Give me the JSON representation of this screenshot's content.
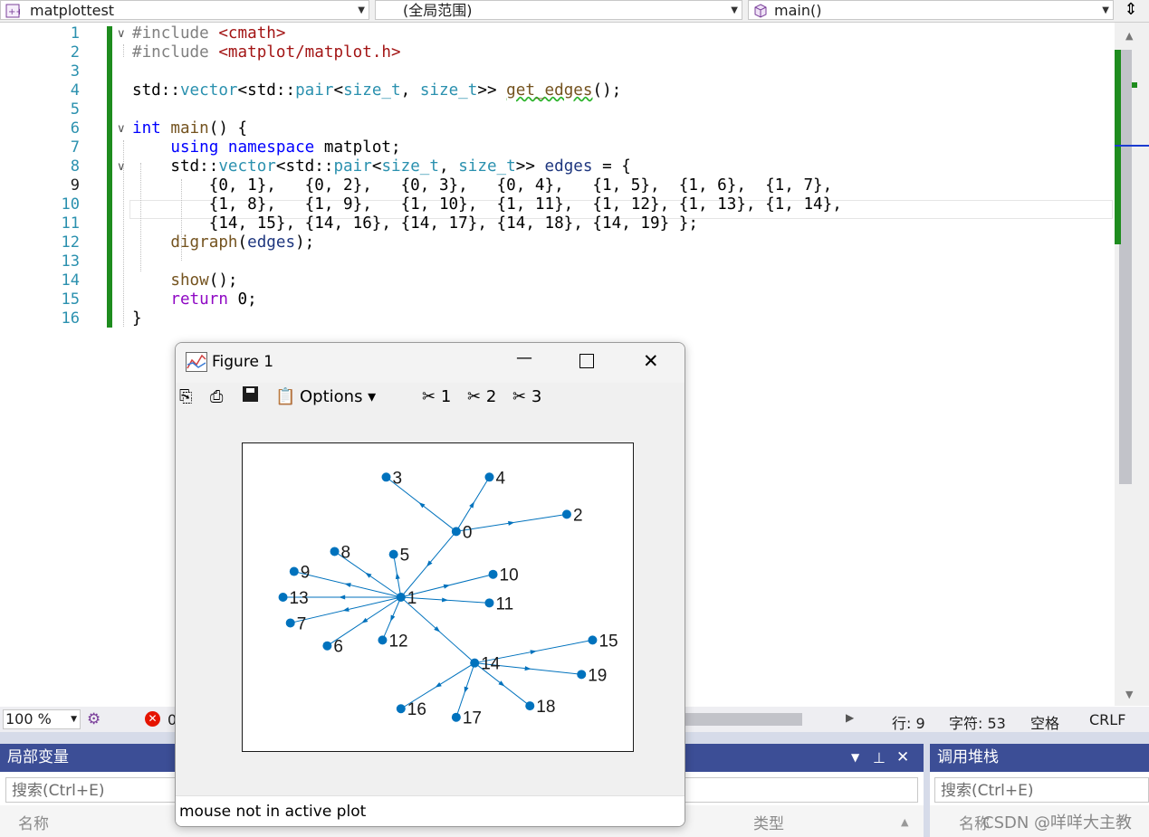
{
  "navbar": {
    "project": "matplottest",
    "scope": "(全局范围)",
    "function": "main()"
  },
  "editor": {
    "line_numbers": [
      "1",
      "2",
      "3",
      "4",
      "5",
      "6",
      "7",
      "8",
      "9",
      "10",
      "11",
      "12",
      "13",
      "14",
      "15",
      "16"
    ],
    "current_line": "9"
  },
  "status": {
    "zoom": "100 %",
    "errors": "0",
    "line": "行: 9",
    "char": "字符: 53",
    "whitespace": "空格",
    "eol": "CRLF"
  },
  "locals_panel": {
    "title": "局部变量",
    "search_placeholder": "搜索(Ctrl+E)",
    "col_name": "名称",
    "col_type": "类型"
  },
  "callstack_panel": {
    "title": "调用堆栈",
    "search_placeholder": "搜索(Ctrl+E)",
    "col_name": "名称"
  },
  "watermark": "CSDN @咩咩大主教",
  "figure": {
    "title": "Figure 1",
    "options_label": "Options",
    "tool_1": "1",
    "tool_2": "2",
    "tool_3": "3",
    "status_text": "mouse not in active plot"
  },
  "chart_data": {
    "type": "digraph",
    "node_color": "#0072bd",
    "nodes": [
      {
        "id": "0",
        "x": 0.55,
        "y": 0.73
      },
      {
        "id": "1",
        "x": 0.4,
        "y": 0.5
      },
      {
        "id": "2",
        "x": 0.85,
        "y": 0.79
      },
      {
        "id": "3",
        "x": 0.36,
        "y": 0.92
      },
      {
        "id": "4",
        "x": 0.64,
        "y": 0.92
      },
      {
        "id": "5",
        "x": 0.38,
        "y": 0.65
      },
      {
        "id": "6",
        "x": 0.2,
        "y": 0.33
      },
      {
        "id": "7",
        "x": 0.1,
        "y": 0.41
      },
      {
        "id": "8",
        "x": 0.22,
        "y": 0.66
      },
      {
        "id": "9",
        "x": 0.11,
        "y": 0.59
      },
      {
        "id": "10",
        "x": 0.65,
        "y": 0.58
      },
      {
        "id": "11",
        "x": 0.64,
        "y": 0.48
      },
      {
        "id": "12",
        "x": 0.35,
        "y": 0.35
      },
      {
        "id": "13",
        "x": 0.08,
        "y": 0.5
      },
      {
        "id": "14",
        "x": 0.6,
        "y": 0.27
      },
      {
        "id": "15",
        "x": 0.92,
        "y": 0.35
      },
      {
        "id": "16",
        "x": 0.4,
        "y": 0.11
      },
      {
        "id": "17",
        "x": 0.55,
        "y": 0.08
      },
      {
        "id": "18",
        "x": 0.75,
        "y": 0.12
      },
      {
        "id": "19",
        "x": 0.89,
        "y": 0.23
      }
    ],
    "edges": [
      [
        "0",
        "1"
      ],
      [
        "0",
        "2"
      ],
      [
        "0",
        "3"
      ],
      [
        "0",
        "4"
      ],
      [
        "1",
        "5"
      ],
      [
        "1",
        "6"
      ],
      [
        "1",
        "7"
      ],
      [
        "1",
        "8"
      ],
      [
        "1",
        "9"
      ],
      [
        "1",
        "10"
      ],
      [
        "1",
        "11"
      ],
      [
        "1",
        "12"
      ],
      [
        "1",
        "13"
      ],
      [
        "1",
        "14"
      ],
      [
        "14",
        "15"
      ],
      [
        "14",
        "16"
      ],
      [
        "14",
        "17"
      ],
      [
        "14",
        "18"
      ],
      [
        "14",
        "19"
      ]
    ]
  }
}
